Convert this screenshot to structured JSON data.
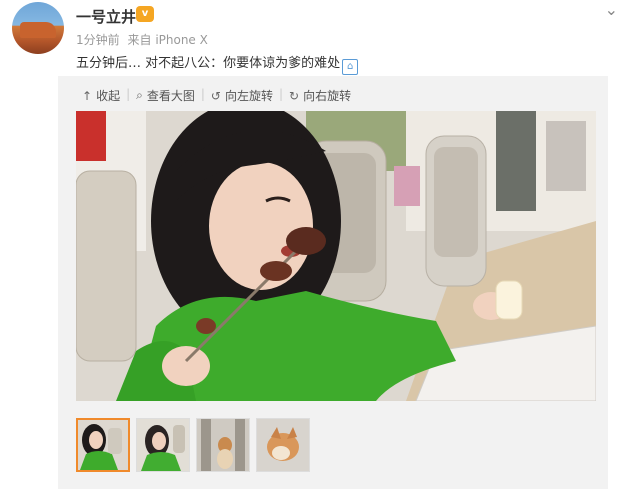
{
  "post": {
    "username": "一号立井",
    "badge": "v",
    "time": "1分钟前",
    "source_prefix": "来自",
    "source": "iPhone X",
    "text": "五分钟后…  对不起八公：你要体谅为爹的难处",
    "emoji_icon": "house-icon"
  },
  "toolbar": {
    "collapse": "收起",
    "view_large": "查看大图",
    "rotate_left": "向左旋转",
    "rotate_right": "向右旋转"
  },
  "icons": {
    "collapse": "↑",
    "view_large": "⌕",
    "rotate_left": "↺",
    "rotate_right": "↻",
    "more": "⌄"
  },
  "thumbnails_count_label": "",
  "colors": {
    "accent": "#f08a2b",
    "green_sweater": "#3eab2c",
    "text": "#333333",
    "meta": "#999999"
  }
}
